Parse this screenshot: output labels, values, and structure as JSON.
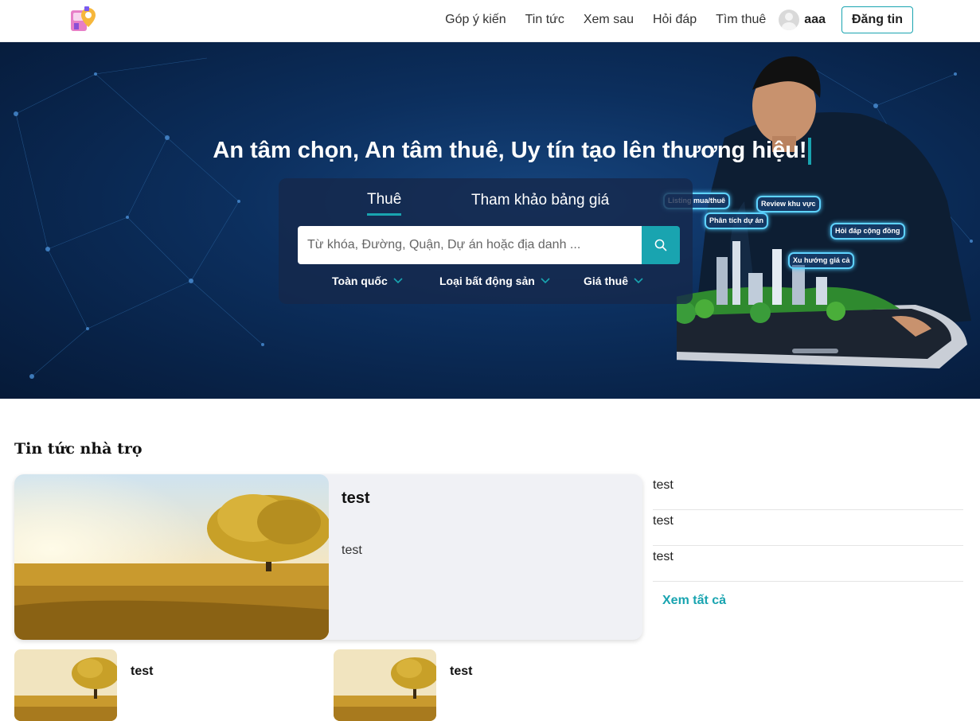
{
  "header": {
    "nav": [
      "Góp ý kiến",
      "Tin tức",
      "Xem sau",
      "Hỏi đáp",
      "Tìm thuê"
    ],
    "user_name": "aaa",
    "post_button": "Đăng tin"
  },
  "hero": {
    "title": "An tâm chọn, An tâm thuê, Uy tín tạo lên thương hiệu!",
    "tabs": [
      "Thuê",
      "Tham khảo bảng giá"
    ],
    "search_placeholder": "Từ khóa, Đường, Quận, Dự án hoặc địa danh ...",
    "filters": [
      "Toàn quốc",
      "Loại bất động sản",
      "Giá thuê"
    ],
    "bubbles": [
      "Listing mua/thuê",
      "Phân tích dự án",
      "Review khu vực",
      "Xu hướng giá cả",
      "Hỏi đáp cộng đồng"
    ],
    "accent_color": "#19a4b0"
  },
  "news": {
    "section_title": "Tin tức nhà trọ",
    "featured": {
      "title": "test",
      "description": "test"
    },
    "side_items": [
      "test",
      "test",
      "test"
    ],
    "see_all": "Xem tất cả",
    "cards": [
      {
        "title": "test"
      },
      {
        "title": "test"
      }
    ]
  }
}
